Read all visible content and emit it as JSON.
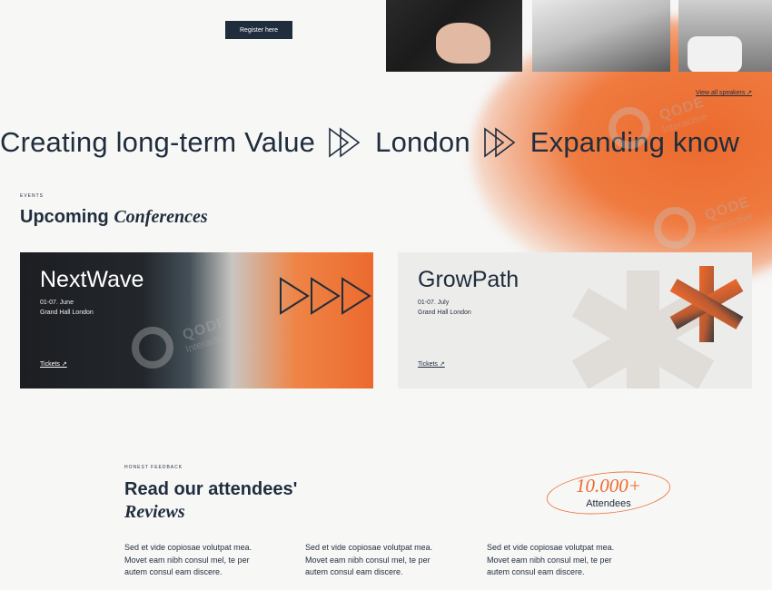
{
  "header": {
    "register_label": "Register here",
    "view_speakers_label": "View all speakers ↗"
  },
  "marquee": {
    "items": [
      "Creating long-term Value",
      "London",
      "Expanding know"
    ]
  },
  "events": {
    "tag": "EVENTS",
    "heading_plain": "Upcoming ",
    "heading_italic": "Conferences",
    "cards": [
      {
        "title": "NextWave",
        "date": "01-07. June",
        "venue": "Grand Hall London",
        "tickets": "Tickets ↗"
      },
      {
        "title": "GrowPath",
        "date": "01-07. July",
        "venue": "Grand Hall London",
        "tickets": "Tickets ↗"
      }
    ]
  },
  "reviews": {
    "tag": "HONEST FEEDBACK",
    "heading_line1": "Read our attendees'",
    "heading_line2": "Reviews",
    "stat_number": "10.000+",
    "stat_label": "Attendees",
    "items": [
      "Sed et vide copiosae volutpat mea. Movet eam nibh consul mel, te per autem consul eam discere.",
      "Sed et vide copiosae volutpat mea. Movet eam nibh consul mel, te per autem consul eam discere.",
      "Sed et vide copiosae volutpat mea. Movet eam nibh consul mel, te per autem consul eam discere."
    ]
  },
  "watermark": {
    "brand": "QODE",
    "sub": "Interactive"
  },
  "colors": {
    "accent": "#ec6a2e",
    "dark": "#1f2d3d",
    "background": "#f7f7f6"
  }
}
